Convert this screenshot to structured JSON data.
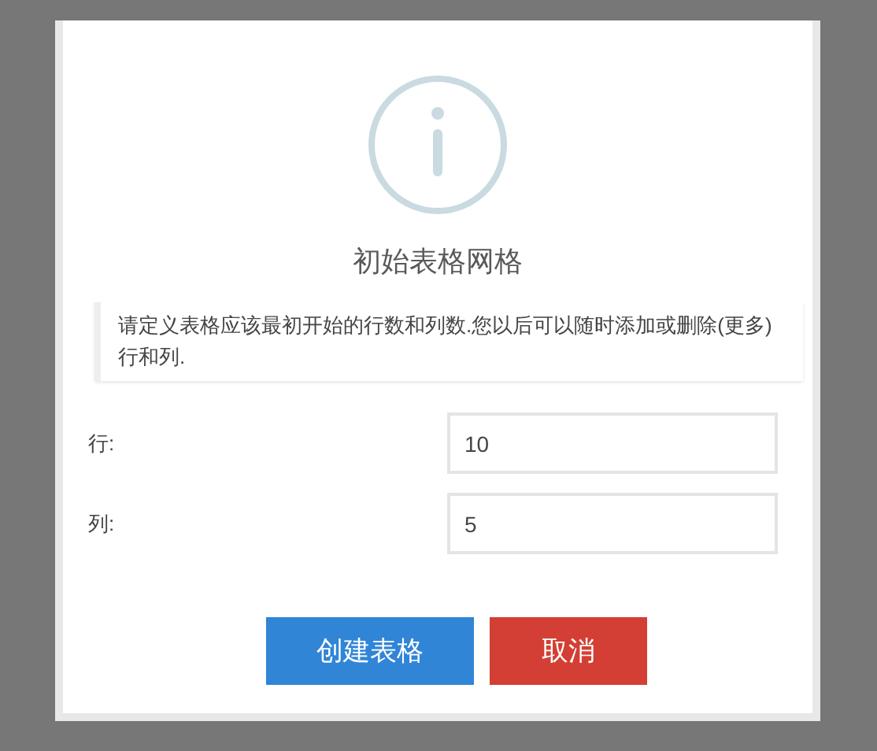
{
  "dialog": {
    "title": "初始表格网格",
    "note": "请定义表格应该最初开始的行数和列数.您以后可以随时添加或删除(更多)行和列.",
    "fields": [
      {
        "label": "行:",
        "value": "10"
      },
      {
        "label": "列:",
        "value": "5"
      }
    ],
    "buttons": [
      {
        "label": "创建表格",
        "kind": "primary"
      },
      {
        "label": "取消",
        "kind": "danger"
      }
    ]
  }
}
